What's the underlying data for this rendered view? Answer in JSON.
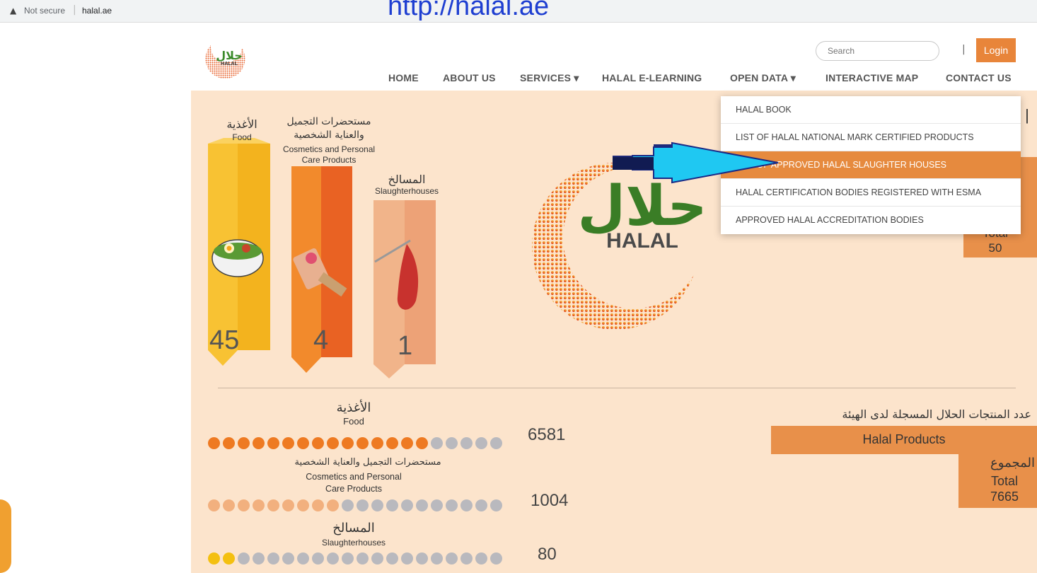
{
  "browser": {
    "security_label": "Not secure",
    "host": "halal.ae"
  },
  "caption": "http://halal.ae",
  "header": {
    "logo_ar": "حلال",
    "logo_en": "HALAL",
    "search_placeholder": "Search",
    "divider": "|",
    "login_label": "Login"
  },
  "nav": {
    "home": "HOME",
    "about": "ABOUT US",
    "services": "SERVICES ▾",
    "elearning": "HALAL E-LEARNING",
    "opendata": "OPEN DATA ▾",
    "map": "INTERACTIVE MAP",
    "contact": "CONTACT US"
  },
  "dropdown": {
    "items": [
      "HALAL BOOK",
      "LIST OF HALAL NATIONAL MARK CERTIFIED PRODUCTS",
      "LIST OF APPROVED HALAL SLAUGHTER HOUSES",
      "HALAL CERTIFICATION BODIES REGISTERED WITH ESMA",
      "APPROVED HALAL ACCREDITATION BODIES"
    ],
    "active_index": 2
  },
  "columns": {
    "food": {
      "ar": "الأغذية",
      "en": "Food",
      "value": "45"
    },
    "cosmetics": {
      "ar1": "مستحضرات التجميل",
      "ar2": "والعناية الشخصية",
      "en1": "Cosmetics and Personal",
      "en2": "Care Products",
      "value": "4"
    },
    "slaughter": {
      "ar": "المسالخ",
      "en": "Slaughterhouses",
      "value": "1"
    }
  },
  "center_logo": {
    "ar": "حلال",
    "en": "HALAL"
  },
  "top_total": {
    "en": "Total",
    "value": "50"
  },
  "products": {
    "food": {
      "ar": "الأغذية",
      "en": "Food",
      "count": "6581",
      "filled": 15,
      "total": 20
    },
    "cosmetics": {
      "ar": "مستحضرات التجميل والعناية الشخصية",
      "en1": "Cosmetics and Personal",
      "en2": "Care Products",
      "count": "1004",
      "filled": 9,
      "total": 20
    },
    "slaughter": {
      "ar": "المسالخ",
      "en": "Slaughterhouses",
      "count": "80",
      "filled": 2,
      "total": 20
    },
    "panel_ar": "عدد المنتجات الحلال المسجلة لدى الهيئة",
    "panel_en": "Halal Products",
    "total_ar": "المجموع",
    "total_en": "Total",
    "total_value": "7665"
  },
  "colors": {
    "accent": "#e8853a",
    "food_dot": "#ee7a22",
    "cosmetics_dot": "#f2b07e",
    "slaughter_dot": "#f4c010",
    "empty_dot": "#b9b9be",
    "arrow": "#19c7f2"
  }
}
